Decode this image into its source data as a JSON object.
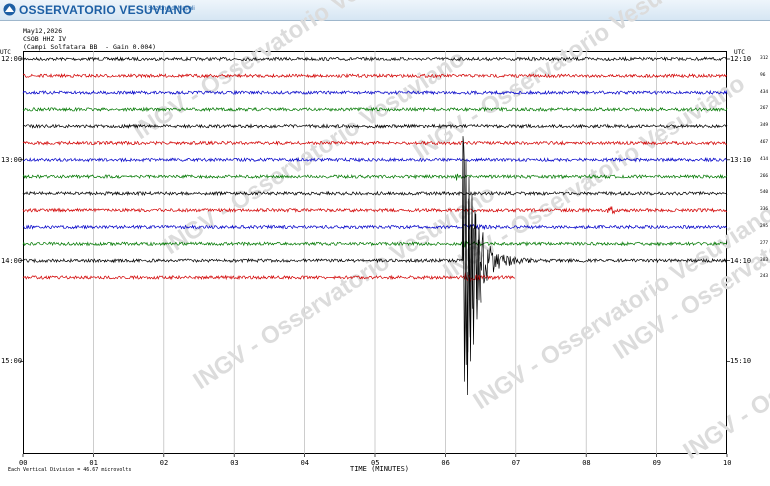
{
  "header": {
    "title": "OSSERVATORIO VESUVIANO",
    "subtitle": "Sezione di Napoli",
    "date": "May12,2026",
    "station": "CSOB HHZ IV",
    "description": "(Campi Solfatara BB  - Gain 0.004)"
  },
  "axis": {
    "left_edge": "UTC",
    "right_edge": "UTC",
    "x_ticks": [
      "00",
      "01",
      "02",
      "03",
      "04",
      "05",
      "06",
      "07",
      "08",
      "09",
      "10"
    ],
    "x_label": "TIME (MINUTES)",
    "footer_note": "Each Vertical Division =   46.67 microvolts"
  },
  "time_labels_left": [
    {
      "label": "12:00",
      "row": 0
    },
    {
      "label": "13:00",
      "row": 6
    },
    {
      "label": "14:00",
      "row": 12
    },
    {
      "label": "15:00",
      "row": 18
    }
  ],
  "time_labels_right": [
    {
      "label": "12:10",
      "row": 0
    },
    {
      "label": "13:10",
      "row": 6
    },
    {
      "label": "14:10",
      "row": 12
    },
    {
      "label": "15:10",
      "row": 18
    }
  ],
  "trace_scales": [
    "312",
    "96",
    "434",
    "267",
    "349",
    "467",
    "414",
    "266",
    "540",
    "336",
    "295",
    "277",
    "383",
    "243"
  ],
  "trace_colors": [
    "#000000",
    "#d20000",
    "#0000c8",
    "#007800"
  ],
  "grid": {
    "rows": 21,
    "minutes": 10
  },
  "traces_count": 14,
  "last_trace_end_minute": 7.0,
  "event": {
    "trace": 12,
    "onset_minute": 6.25,
    "max_amplitude_rows": 8
  },
  "watermark": "INGV - Osservatorio Vesuviano"
}
